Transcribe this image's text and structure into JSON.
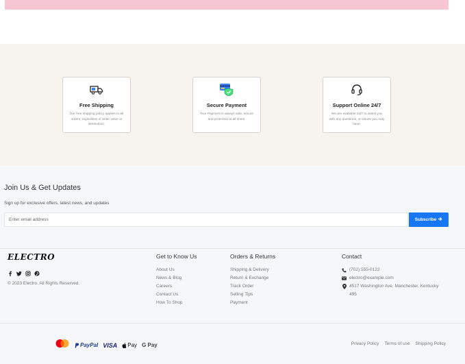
{
  "features": {
    "items": [
      {
        "title": "Free Shipping",
        "icon": "truck-icon",
        "description": "Our free shipping policy applies to all orders, regardless of order value or destination."
      },
      {
        "title": "Secure Payment",
        "icon": "credit-card-shield-icon",
        "description": "Your Payment is always safe, secure and protected at all times."
      },
      {
        "title": "Support Online 24/7",
        "icon": "headset-icon",
        "description": "We are available 24/7 to assist you with any questions, or issues you may have."
      }
    ]
  },
  "newsletter": {
    "title": "Join Us & Get Updates",
    "subtitle": "Sign up for exclusive offers, latest news, and updates",
    "placeholder": "Enter email address",
    "button_label": "Subscribe"
  },
  "footer": {
    "logo": "ELECTRO",
    "socials": [
      "facebook-icon",
      "twitter-icon",
      "instagram-icon",
      "pinterest-icon"
    ],
    "copyright": "© 2023 Electro. All Rights Reserved.",
    "get_to_know": {
      "title": "Get to Know Us",
      "links": [
        "About Us",
        "News & Blog",
        "Careers",
        "Contact Us",
        "How To Shop"
      ]
    },
    "orders_returns": {
      "title": "Orders & Returns",
      "links": [
        "Shipping & Delivery",
        "Return & Exchange",
        "Track Order",
        "Selling Tips",
        "Payment"
      ]
    },
    "contact": {
      "title": "Contact",
      "phone": "(702) 555-0122",
      "email": "electro@example.com",
      "address": "4517 Washington Ave. Manchester, Kentucky 495"
    },
    "payments": [
      "mastercard-icon",
      "PayPal",
      "VISA",
      "Pay",
      "G Pay"
    ],
    "policies": [
      "Privacy Policy",
      "Terms of use",
      "Shipping Policy"
    ]
  },
  "colors": {
    "accent": "#1677f5",
    "banner": "#f6c7d2",
    "features_bg": "#f7f3ef",
    "footer_bg": "#f6f7f9"
  }
}
